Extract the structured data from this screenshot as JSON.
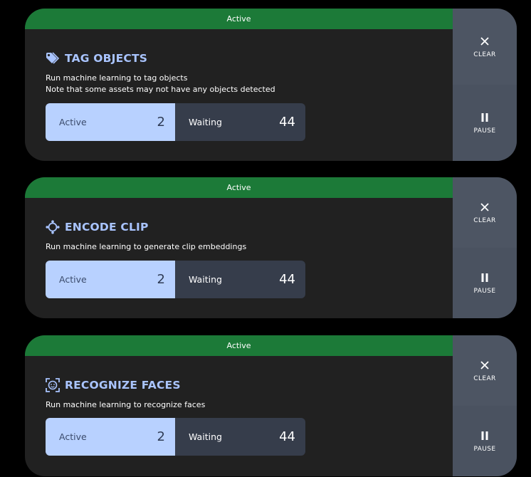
{
  "jobs": [
    {
      "status": "Active",
      "icon": "tag-icon",
      "title": "TAG OBJECTS",
      "description_lines": [
        "Run machine learning to tag objects",
        "Note that some assets may not have any objects detected"
      ],
      "active_label": "Active",
      "active_count": "2",
      "waiting_label": "Waiting",
      "waiting_count": "44",
      "clear_label": "CLEAR",
      "pause_label": "PAUSE"
    },
    {
      "status": "Active",
      "icon": "encode-clip-icon",
      "title": "ENCODE CLIP",
      "description_lines": [
        "Run machine learning to generate clip embeddings"
      ],
      "active_label": "Active",
      "active_count": "2",
      "waiting_label": "Waiting",
      "waiting_count": "44",
      "clear_label": "CLEAR",
      "pause_label": "PAUSE"
    },
    {
      "status": "Active",
      "icon": "face-recognition-icon",
      "title": "RECOGNIZE FACES",
      "description_lines": [
        "Run machine learning to recognize faces"
      ],
      "active_label": "Active",
      "active_count": "2",
      "waiting_label": "Waiting",
      "waiting_count": "44",
      "clear_label": "CLEAR",
      "pause_label": "PAUSE"
    }
  ],
  "colors": {
    "status_bar": "#1c7a38",
    "title": "#a9c4ff",
    "card": "#212121",
    "active_count_bg": "#b8d1ff",
    "waiting_count_bg": "#363d4b",
    "action_bg": "#4d5563"
  }
}
